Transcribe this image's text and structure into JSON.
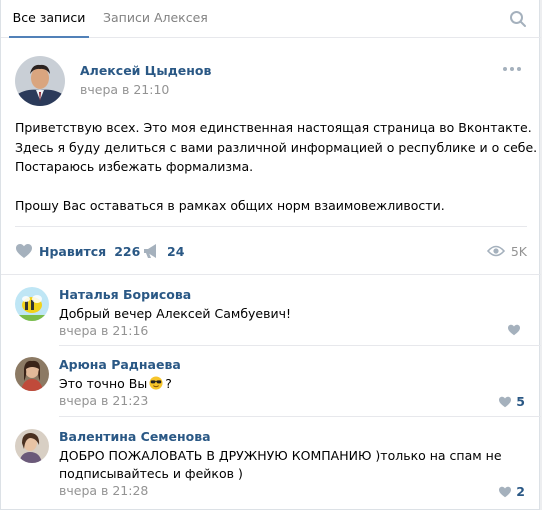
{
  "tabs": {
    "all_posts": "Все записи",
    "user_posts": "Записи Алексея"
  },
  "post": {
    "author": "Алексей Цыденов",
    "date": "вчера в 21:10",
    "lines": [
      "Приветствую всех. Это моя единственная настоящая страница во Вконтакте.",
      "Здесь я буду делиться с вами различной информацией о республике и о себе.",
      "Постараюсь избежать формализма.",
      "Прошу Вас оставаться в рамках общих норм взаимовежливости."
    ],
    "like_label": "Нравится",
    "like_count": "226",
    "share_count": "24",
    "views": "5K"
  },
  "comments": [
    {
      "name": "Наталья Борисова",
      "text": "Добрый вечер Алексей Самбуевич!",
      "date": "вчера в 21:16",
      "likes": ""
    },
    {
      "name": "Арюна Раднаева",
      "text_before": "Это точно Вы",
      "text_after": "?",
      "emoji": "sunglasses-emoji",
      "date": "вчера в 21:23",
      "likes": "5"
    },
    {
      "name": "Валентина Семенова",
      "text_line1": "ДОБРО ПОЖАЛОВАТЬ В ДРУЖНУЮ КОМПАНИЮ )только на спам не",
      "text_line2": "подписывайтесь и фейков )",
      "date": "вчера в 21:28",
      "likes": "2"
    }
  ],
  "colors": {
    "link": "#2a5885",
    "muted": "#939393",
    "tab_accent": "#5181b8",
    "icon": "#a5b1bd"
  }
}
